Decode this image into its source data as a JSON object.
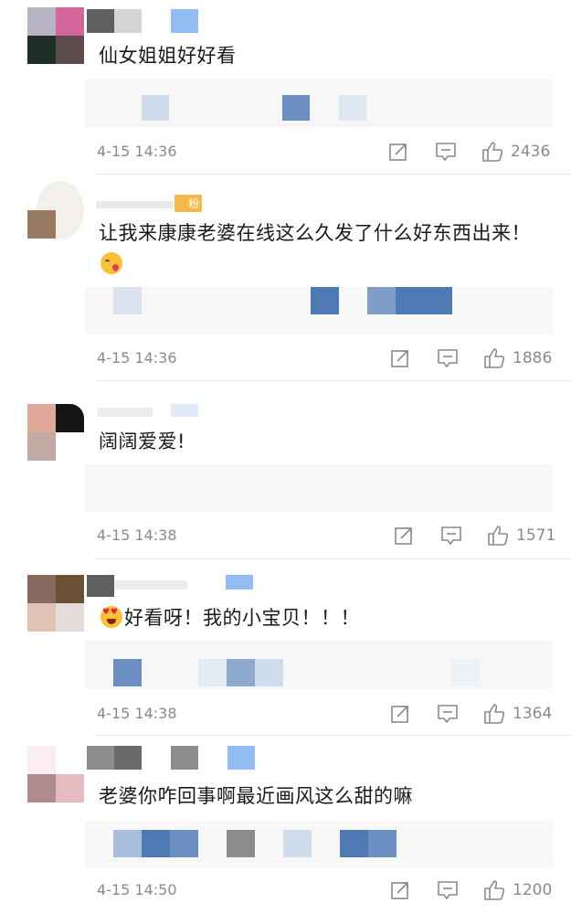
{
  "comments": [
    {
      "text": "仙女姐姐好好看",
      "time": "4-15 14:36",
      "likes": "2436",
      "reply_blocks": [
        "#cfdcec",
        "#6a8fc0",
        "#dfe7f1"
      ]
    },
    {
      "badge": "粉",
      "text": "让我来康康老婆在线这么久发了什么好东西出来！",
      "emoji": "face-blowing-kiss-icon",
      "time": "4-15 14:36",
      "likes": "1886",
      "reply_blocks": [
        "#d9e2ee",
        "#4f79b3",
        "#809fc8",
        "#4f79b3",
        "#4f79b3"
      ]
    },
    {
      "text": "阔阔爱爱!",
      "time": "4-15 14:38",
      "likes": "1571",
      "reply_blocks": []
    },
    {
      "emoji": "heart-eyes-face-icon",
      "text": "好看呀！我的小宝贝！！！",
      "time": "4-15 14:38",
      "likes": "1364",
      "reply_blocks": [
        "#6a8fc0",
        "#e5ebf3",
        "#8ea9cd",
        "#cfdcec",
        "#eef2f7"
      ]
    },
    {
      "text": "老婆你咋回事啊最近画风这么甜的嘛",
      "time": "4-15 14:50",
      "likes": "1200",
      "reply_blocks": [
        "#a7bddb",
        "#4f79b3",
        "#6a8fc0",
        "#8c8c8c",
        "#cfdcec",
        "#4f79b3",
        "#6a8fc0"
      ]
    }
  ],
  "icons": {
    "share": "share-icon",
    "comment": "comment-icon",
    "like": "thumbs-up-icon"
  },
  "colors": {
    "text": "#1a1a1a",
    "meta": "#8a8a8a",
    "reply_bg": "#f7f7f7",
    "badge": "#f5a623"
  }
}
